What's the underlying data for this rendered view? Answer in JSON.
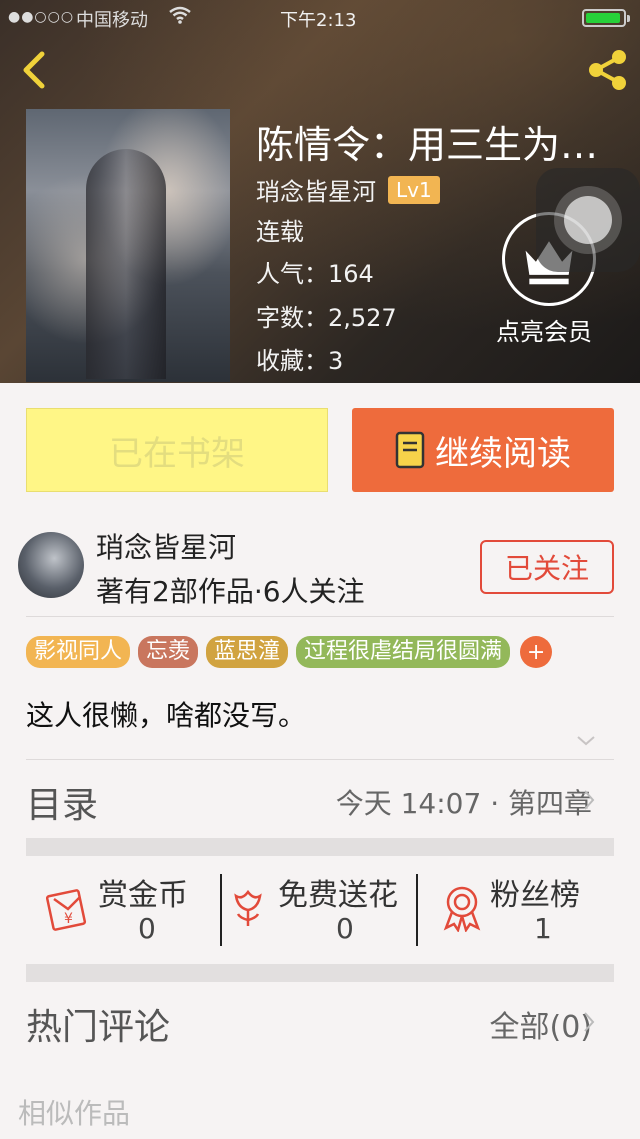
{
  "status_bar": {
    "signal": "●●○○○",
    "carrier": "中国移动",
    "time": "下午2:13"
  },
  "book": {
    "title": "陈情令：用三生为…",
    "author": "琑念皆星河",
    "author_level": "Lv1",
    "status": "连载",
    "popularity": "人气：164",
    "word_count": "字数：2,527",
    "favorites": "收藏：3"
  },
  "vip": {
    "label": "点亮会员"
  },
  "actions": {
    "shelf_label": "已在书架",
    "read_label": "继续阅读"
  },
  "author_card": {
    "name": "琑念皆星河",
    "stats": "著有2部作品·6人关注",
    "follow_label": "已关注"
  },
  "tags": [
    {
      "label": "影视同人",
      "color": "#f2b552"
    },
    {
      "label": "忘羡",
      "color": "#c9765e"
    },
    {
      "label": "蓝思潼",
      "color": "#d1a340"
    },
    {
      "label": "过程很虐结局很圆满",
      "color": "#93b85a"
    }
  ],
  "intro": "这人很懒，啥都没写。",
  "toc": {
    "label": "目录",
    "update": "今天 14:07 · 第四章"
  },
  "rewards": [
    {
      "label": "赏金币",
      "value": "0",
      "icon": "red-envelope-icon"
    },
    {
      "label": "免费送花",
      "value": "0",
      "icon": "flower-icon"
    },
    {
      "label": "粉丝榜",
      "value": "1",
      "icon": "ribbon-medal-icon"
    }
  ],
  "comments": {
    "label": "热门评论",
    "all_label": "全部(0)"
  },
  "similar": {
    "label": "相似作品"
  },
  "colors": {
    "accent": "#ee6b3c",
    "follow": "#e24a3a",
    "shelf_bg": "#fff686",
    "battery": "#27d13a"
  }
}
